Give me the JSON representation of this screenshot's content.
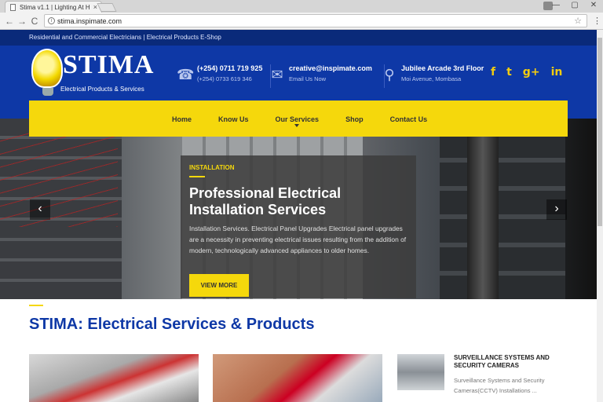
{
  "browser": {
    "tab_title": "Stima v1.1 | Lighting At H",
    "tab_close": "×",
    "url": "stima.inspimate.com",
    "back": "←",
    "forward": "→",
    "reload": "C",
    "star": "☆",
    "menu": "⋮",
    "minimize": "—",
    "maximize": "▢",
    "close": "✕"
  },
  "site": {
    "tagline": "Residential and Commercial Electricians | Electrical Products E-Shop",
    "logo_text": "STIMA",
    "logo_sub": "Electrical Products & Services",
    "contacts": [
      {
        "icon": "phone-icon",
        "glyph": "☎",
        "line1": "(+254) 0711 719 925",
        "line2": "(+254) 0733 619 346"
      },
      {
        "icon": "mail-icon",
        "glyph": "✉",
        "line1": "creative@inspimate.com",
        "line2": "Email Us Now"
      },
      {
        "icon": "map-pin-icon",
        "glyph": "⚲",
        "line1": "Jubilee Arcade 3rd Floor",
        "line2": "Moi Avenue, Mombasa"
      }
    ],
    "social": [
      "f",
      "t",
      "g+",
      "in"
    ],
    "nav": [
      "Home",
      "Know Us",
      "Our Services",
      "Shop",
      "Contact Us"
    ],
    "hero": {
      "label": "INSTALLATION",
      "title": "Professional Electrical Installation Services",
      "text": "Installation Services. Electrical Panel Upgrades Electrical panel upgrades are a necessity in preventing electrical issues resulting from the addition of modern, technologically advanced appliances to older homes.",
      "button": "VIEW MORE",
      "prev": "‹",
      "next": "›"
    },
    "section_title": "STIMA: Electrical Services & Products",
    "product": {
      "title": "SURVEILLANCE SYSTEMS AND SECURITY CAMERAS",
      "text": "Surveillance Systems and Security Cameras(CCTV) Installations ..."
    }
  },
  "colors": {
    "brand_blue": "#0e38a6",
    "accent_yellow": "#f5d80c"
  }
}
